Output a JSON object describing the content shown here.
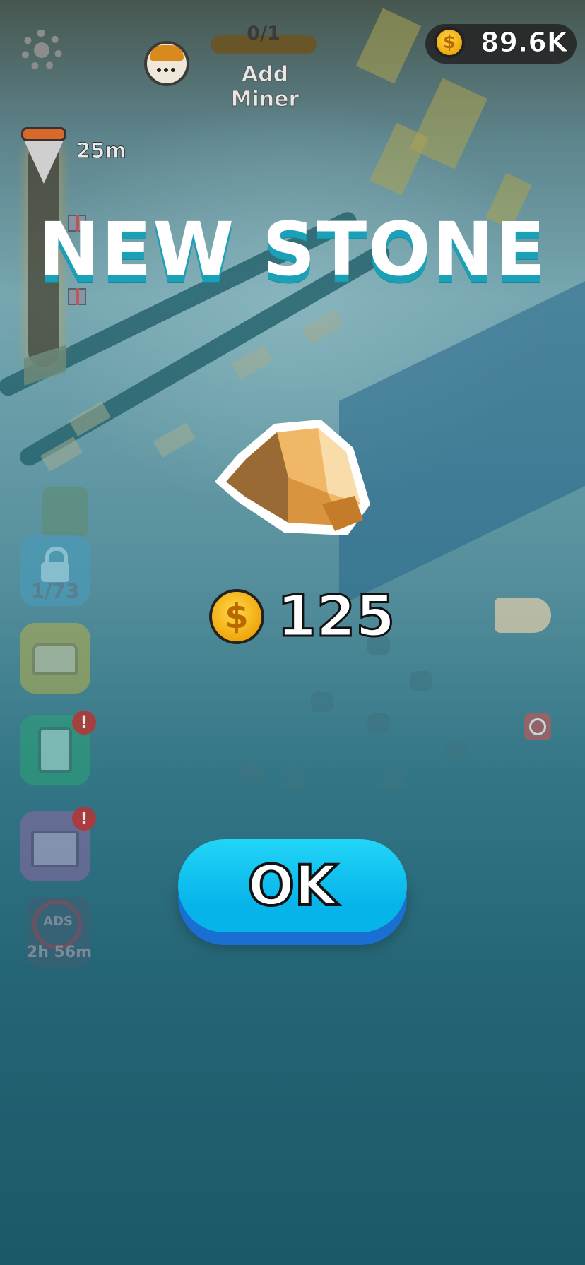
{
  "hud": {
    "settings_icon": "gear-icon",
    "miner_count": "0/1",
    "miner_progress": 0,
    "add_miner_label": "Add Miner",
    "coin_total": "89.6K",
    "coin_symbol": "$"
  },
  "depth_meter": {
    "depth_label": "25m",
    "icons": [
      "drill-icon",
      "gift-icon",
      "gift-icon",
      "ore-base-icon"
    ]
  },
  "sidebar": {
    "collection_count": "1/73",
    "noads_label": "ADS",
    "noads_timer": "2h 56m",
    "alert_mark": "!"
  },
  "popup": {
    "title": "NEW STONE",
    "reward_value": "125",
    "reward_coin_symbol": "$",
    "ok_label": "OK"
  },
  "colors": {
    "title_fill": "#ffffff",
    "title_shadow": "#1aa1b8",
    "ok_button": "#07b4ea",
    "coin": "#f0a80c",
    "stone": "#e3a75a"
  }
}
